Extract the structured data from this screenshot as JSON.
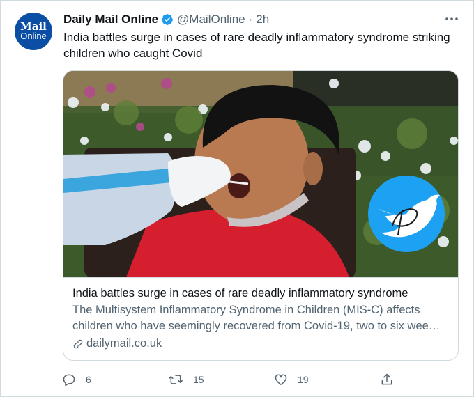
{
  "account": {
    "avatar_line1": "Mail",
    "avatar_line2": "Online",
    "name": "Daily Mail Online",
    "handle": "@MailOnline",
    "separator": "·",
    "time": "2h"
  },
  "tweet": {
    "text": "India battles surge in cases of rare deadly inflammatory syndrome striking children who caught Covid"
  },
  "card": {
    "title": "India battles surge in cases of rare deadly inflammatory syndrome",
    "description": "The Multisystem Inflammatory Syndrome in Children (MIS-C) affects children who have seemingly recovered from Covid-19, two to six wee…",
    "domain": "dailymail.co.uk"
  },
  "actions": {
    "reply_count": "6",
    "retweet_count": "15",
    "like_count": "19"
  },
  "colors": {
    "accent": "#1d9bf0",
    "text_primary": "#0f1419",
    "text_secondary": "#536471",
    "border": "#cfd9de",
    "avatar_bg": "#0a4fa3"
  },
  "icons": [
    "verified-badge-icon",
    "more-icon",
    "link-icon",
    "reply-icon",
    "retweet-icon",
    "like-icon",
    "share-icon",
    "watermark-bird-icon"
  ]
}
